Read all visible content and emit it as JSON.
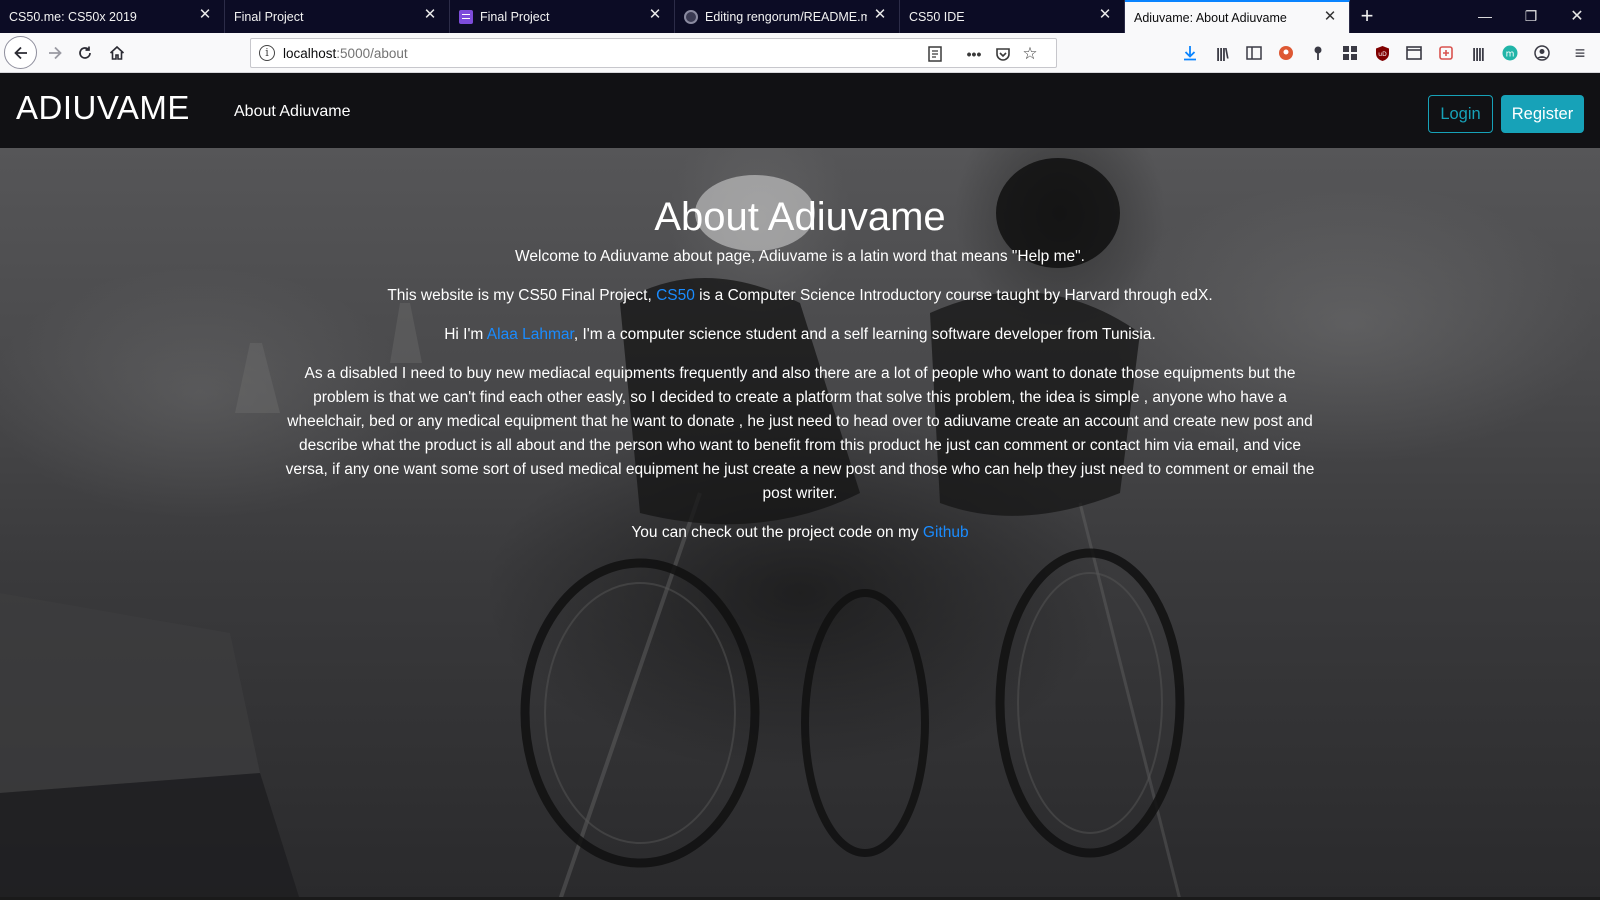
{
  "tabs": [
    {
      "title": "CS50.me: CS50x 2019",
      "favicon": "none"
    },
    {
      "title": "Final Project",
      "favicon": "none"
    },
    {
      "title": "Final Project",
      "favicon": "list-icon"
    },
    {
      "title": "Editing rengorum/README.md",
      "favicon": "github-icon"
    },
    {
      "title": "CS50 IDE",
      "favicon": "none"
    },
    {
      "title": "Adiuvame: About Adiuvame",
      "favicon": "none",
      "active": true
    }
  ],
  "address": {
    "host": "localhost",
    "path": ":5000/about"
  },
  "site": {
    "brand": "ADIUVAME",
    "nav_about": "About Adiuvame",
    "login": "Login",
    "register": "Register"
  },
  "about": {
    "title": "About Adiuvame",
    "p1": "Welcome to Adiuvame about page, Adiuvame is a latin word that means \"Help me\".",
    "p2_before": "This website is my CS50 Final Project, ",
    "p2_link": "CS50",
    "p2_after": " is a Computer Science Introductory course taught by Harvard through edX.",
    "p3_before": "Hi I'm ",
    "p3_link": "Alaa Lahmar",
    "p3_after": ", I'm a computer science student and a self learning software developer from Tunisia.",
    "p4": "As a disabled I need to buy new mediacal equipments frequently and also there are a lot of people who want to donate those equipments but the problem is that we can't find each other easly, so I decided to create a platform that solve this problem, the idea is simple , anyone who have a wheelchair, bed or any medical equipment that he want to donate , he just need to head over to adiuvame create an account and create new post and describe what the product is all about and the person who want to benefit from this product he just can comment or contact him via email, and vice versa, if any one want some sort of used medical equipment he just create a new post and those who can help they just need to comment or email the post writer.",
    "p5_before": "You can check out the project code on my ",
    "p5_link": "Github"
  },
  "colors": {
    "accent": "#17a2b8",
    "link": "#1a8cff",
    "tab_active_border": "#0a84ff"
  }
}
